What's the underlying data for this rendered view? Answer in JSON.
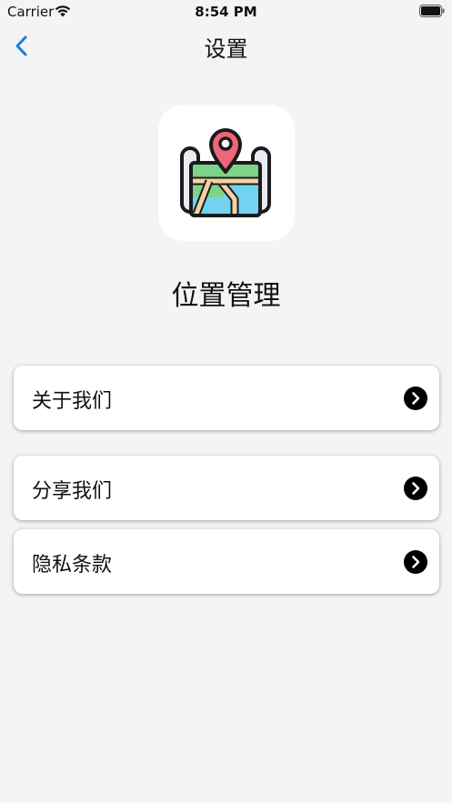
{
  "status_bar": {
    "carrier": "Carrier",
    "time": "8:54 PM"
  },
  "nav": {
    "title": "设置",
    "back_icon": "chevron-left-icon",
    "accent": "#1a7de0"
  },
  "app": {
    "name": "位置管理",
    "icon": "map-pin-icon"
  },
  "menu": {
    "items": [
      {
        "label": "关于我们",
        "icon": "chevron-right-circle-icon"
      },
      {
        "label": "分享我们",
        "icon": "chevron-right-circle-icon"
      },
      {
        "label": "隐私条款",
        "icon": "chevron-right-circle-icon"
      }
    ]
  }
}
